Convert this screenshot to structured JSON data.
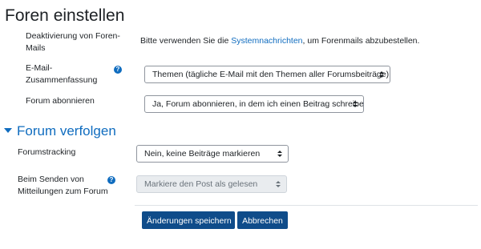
{
  "page_title": "Foren einstellen",
  "colors": {
    "link": "#0f6cbf",
    "button": "#0f4c8a"
  },
  "fields": {
    "deactivation": {
      "label": "Deaktivierung von Foren-Mails",
      "text_before": "Bitte verwenden Sie die ",
      "link": "Systemnachrichten",
      "text_after": ", um Forenmails abzubestellen."
    },
    "digest": {
      "label": "E-Mail-Zusammenfassung",
      "help_icon": "question-circle-icon",
      "value": "Themen (tägliche E-Mail mit den Themen aller Forumsbeiträge)"
    },
    "subscribe": {
      "label": "Forum abonnieren",
      "value": "Ja, Forum abonnieren, in dem ich einen Beitrag schreibe"
    }
  },
  "section": {
    "title": "Forum verfolgen",
    "icon": "triangle-down-icon"
  },
  "tracking": {
    "label": "Forumstracking",
    "value": "Nein, keine Beiträge markieren"
  },
  "mark_on_reply": {
    "label": "Beim Senden von Mitteilungen zum Forum",
    "help_icon": "question-circle-icon",
    "value": "Markiere den Post als gelesen",
    "disabled": true
  },
  "buttons": {
    "save": "Änderungen speichern",
    "cancel": "Abbrechen"
  }
}
